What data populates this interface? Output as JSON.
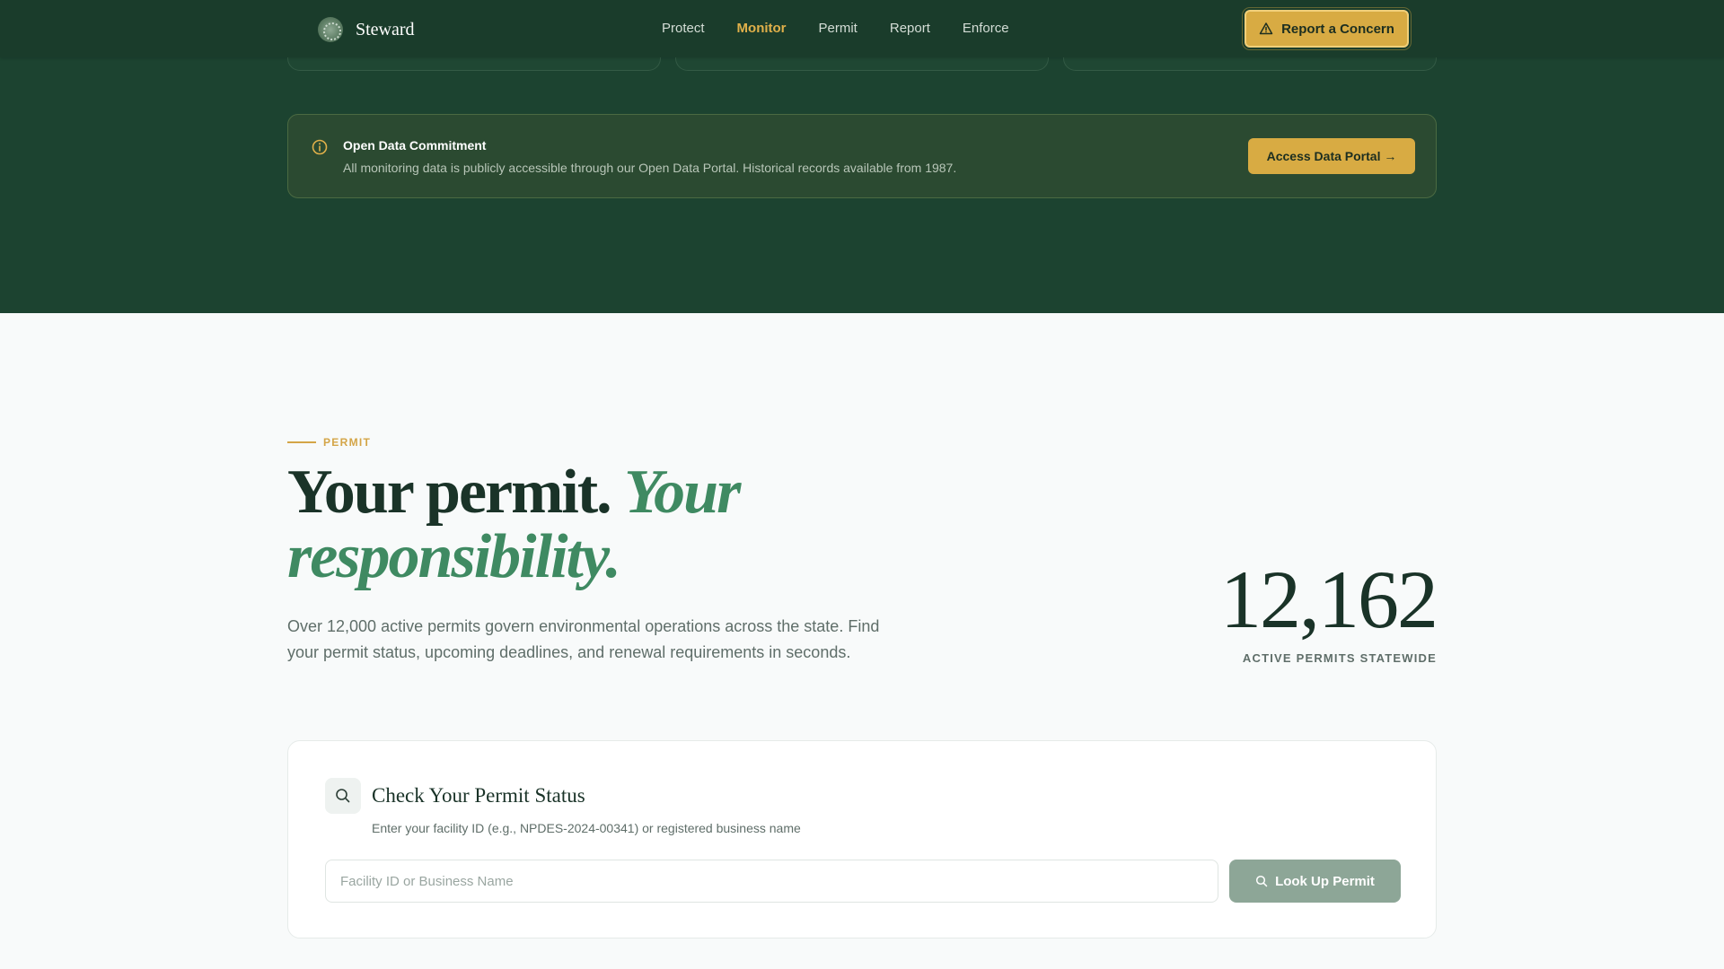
{
  "colors": {
    "nav_bg": "#1a3c2b",
    "hero_bg": "#1c4330",
    "accent_gold": "#d8ab43",
    "accent_green": "#3f8a62",
    "page_bg": "#f8fafa"
  },
  "brand": {
    "name": "Steward",
    "logo_icon": "leaf-seal-icon"
  },
  "nav": {
    "links": [
      {
        "label": "Protect",
        "active": false
      },
      {
        "label": "Monitor",
        "active": true
      },
      {
        "label": "Permit",
        "active": false
      },
      {
        "label": "Report",
        "active": false
      },
      {
        "label": "Enforce",
        "active": false
      }
    ],
    "cta_label": "Report a Concern",
    "cta_icon": "warning-triangle-icon"
  },
  "banner": {
    "icon": "info-icon",
    "title": "Open Data Commitment",
    "text": "All monitoring data is publicly accessible through our Open Data Portal. Historical records available from 1987.",
    "button_label": "Access Data Portal →"
  },
  "permit": {
    "eyebrow": "PERMIT",
    "headline_plain": "Your permit.",
    "headline_emphasis": "Your responsibility.",
    "intro": "Over 12,000 active permits govern environmental operations across the state. Find your permit status, upcoming deadlines, and renewal requirements in seconds.",
    "stat_value": "12,162",
    "stat_caption": "ACTIVE PERMITS STATEWIDE"
  },
  "lookup": {
    "icon": "search-icon",
    "title": "Check Your Permit Status",
    "subtitle": "Enter your facility ID (e.g., NPDES-2024-00341) or registered business name",
    "input_value": "",
    "input_placeholder": "Facility ID or Business Name",
    "button_label": "Look Up Permit"
  }
}
